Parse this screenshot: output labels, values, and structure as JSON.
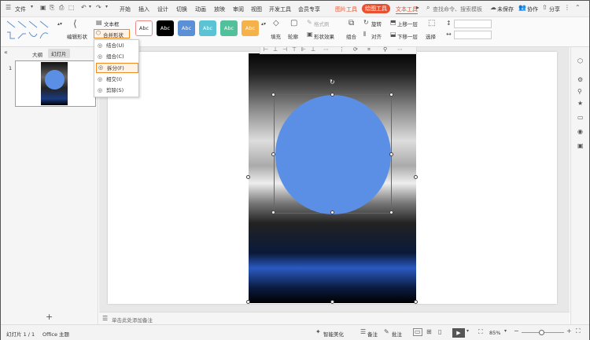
{
  "menubar": {
    "file_label": "文件",
    "tabs": [
      "开始",
      "插入",
      "设计",
      "切换",
      "动画",
      "放映",
      "审阅",
      "视图",
      "开发工具",
      "会员专享"
    ],
    "context_tabs": [
      "图片工具",
      "绘图工具",
      "文本工具"
    ],
    "active_tab": "绘图工具",
    "search_placeholder": "查找命令、搜索模板",
    "unsaved": "未保存",
    "collab": "协作",
    "share": "分享"
  },
  "ribbon": {
    "edit_shape": "编辑形状",
    "text_box": "文本框",
    "merge_shapes": "合并形状",
    "style_samples": [
      "Abc",
      "Abc",
      "Abc",
      "Abc",
      "Abc",
      "Abc"
    ],
    "style_colors": [
      "#ffffff",
      "#000000",
      "#5b8fd6",
      "#5bc3d3",
      "#52c09a",
      "#f5b14a"
    ],
    "fill": "填充",
    "outline": "轮廓",
    "format_painter": "格式刷",
    "shape_effects": "形状效果",
    "group": "组合",
    "rotate": "旋转",
    "align": "对齐",
    "bring_forward": "上移一层",
    "send_backward": "下移一层",
    "select": "选择"
  },
  "dropdown": {
    "items": [
      "结合(U)",
      "组合(C)",
      "拆分(F)",
      "相交(I)",
      "剪除(S)"
    ],
    "highlighted": "拆分(F)"
  },
  "leftpane": {
    "tabs": [
      "大纲",
      "幻灯片"
    ],
    "active_tab": "幻灯片",
    "slide_number": "1"
  },
  "notes_placeholder": "单击此处添加备注",
  "statusbar": {
    "slide_info": "幻灯片 1 / 1",
    "theme": "Office 主题",
    "beautify": "智能美化",
    "notes": "备注",
    "comments": "批注",
    "zoom": "85%"
  },
  "colors": {
    "accent_orange": "#f08a24",
    "active_tab_bg": "#e8502f",
    "circle_fill": "#5b8fe6"
  }
}
